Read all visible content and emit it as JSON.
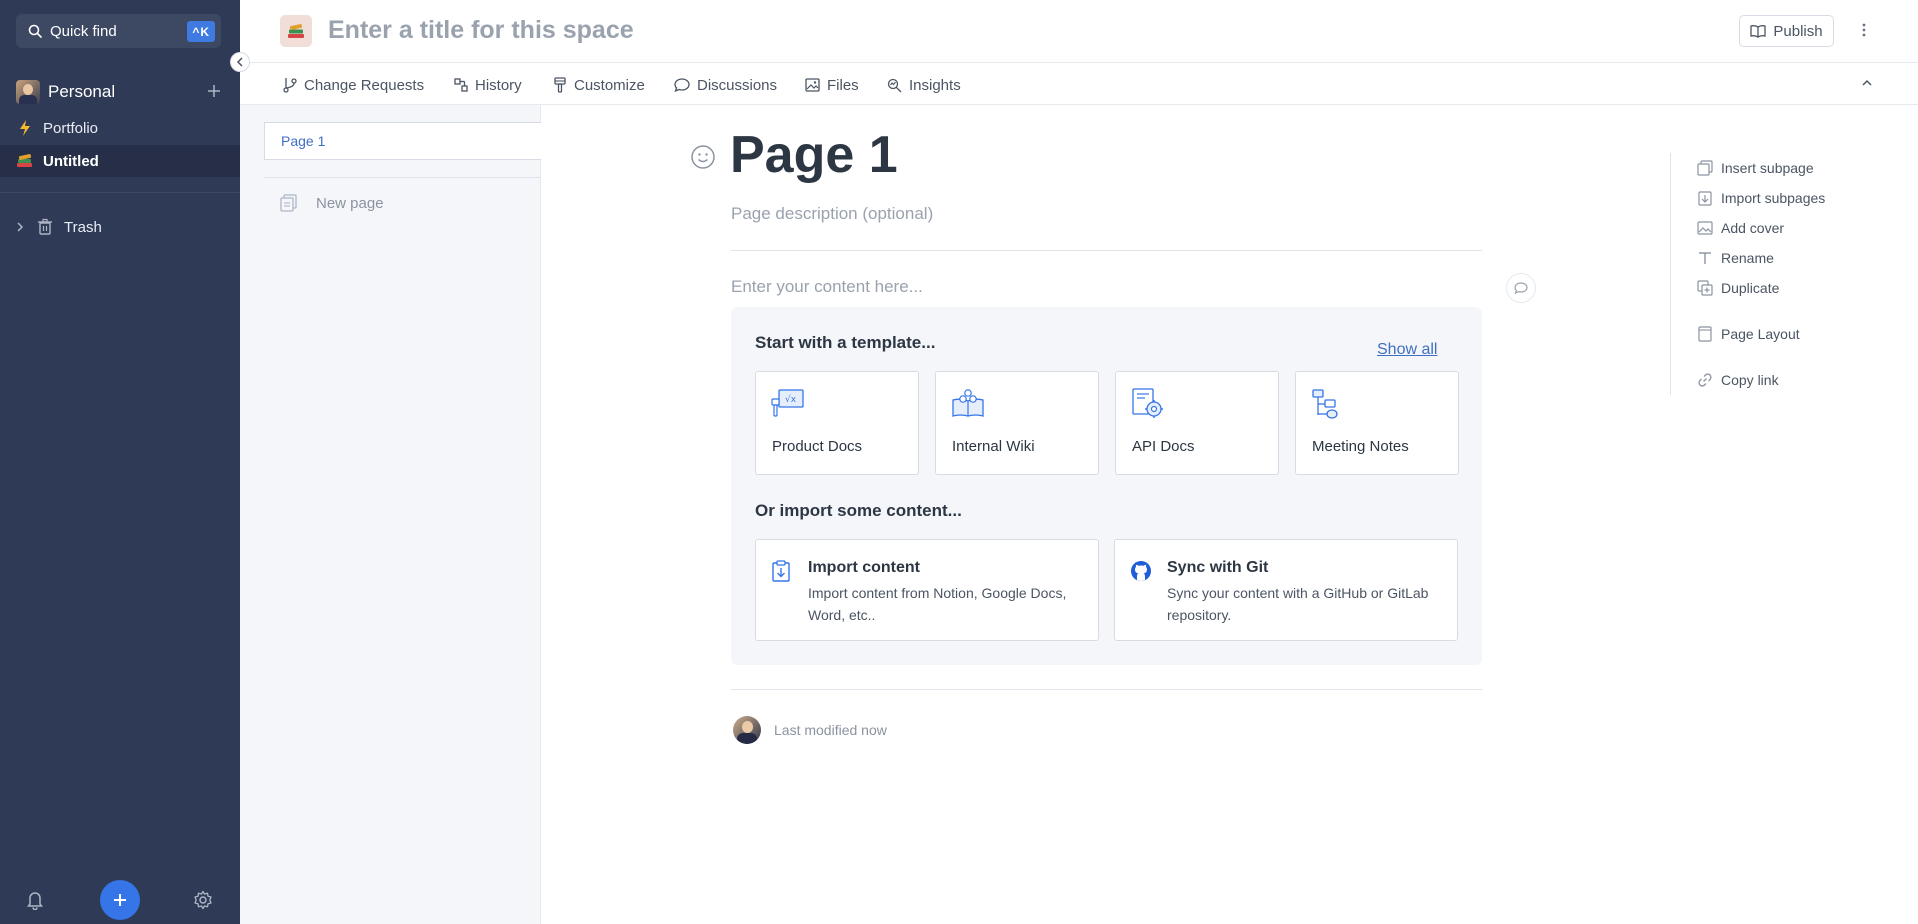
{
  "sidebar": {
    "quickfind_label": "Quick find",
    "quickfind_shortcut": "^K",
    "space_name": "Personal",
    "items": [
      {
        "label": "Portfolio",
        "icon": "lightning-icon"
      },
      {
        "label": "Untitled",
        "icon": "books-icon",
        "active": true
      }
    ],
    "trash_label": "Trash"
  },
  "header": {
    "title_placeholder": "Enter a title for this space",
    "publish_label": "Publish"
  },
  "tabs": [
    {
      "label": "Change Requests",
      "icon": "branch-icon"
    },
    {
      "label": "History",
      "icon": "history-icon"
    },
    {
      "label": "Customize",
      "icon": "brush-icon"
    },
    {
      "label": "Discussions",
      "icon": "chat-icon"
    },
    {
      "label": "Files",
      "icon": "image-icon"
    },
    {
      "label": "Insights",
      "icon": "insights-icon"
    }
  ],
  "tree": {
    "page_label": "Page 1",
    "new_page_label": "New page"
  },
  "page": {
    "title": "Page 1",
    "description_placeholder": "Page description (optional)",
    "content_placeholder": "Enter your content here..."
  },
  "templates": {
    "heading": "Start with a template...",
    "show_all": "Show all",
    "cards": [
      {
        "label": "Product Docs",
        "icon": "product-docs-icon"
      },
      {
        "label": "Internal Wiki",
        "icon": "internal-wiki-icon"
      },
      {
        "label": "API Docs",
        "icon": "api-docs-icon"
      },
      {
        "label": "Meeting Notes",
        "icon": "meeting-notes-icon"
      }
    ],
    "import_heading": "Or import some content...",
    "import_cards": [
      {
        "title": "Import content",
        "desc": "Import content from Notion, Google Docs, Word, etc..",
        "icon": "import-icon"
      },
      {
        "title": "Sync with Git",
        "desc": "Sync your content with a GitHub or GitLab repository.",
        "icon": "github-icon"
      }
    ]
  },
  "footer": {
    "last_modified": "Last modified now"
  },
  "actions": [
    {
      "label": "Insert subpage",
      "icon": "insert-subpage-icon"
    },
    {
      "label": "Import subpages",
      "icon": "import-subpages-icon"
    },
    {
      "label": "Add cover",
      "icon": "add-cover-icon"
    },
    {
      "label": "Rename",
      "icon": "rename-icon"
    },
    {
      "label": "Duplicate",
      "icon": "duplicate-icon"
    },
    {
      "label": "Page Layout",
      "icon": "page-layout-icon"
    },
    {
      "label": "Copy link",
      "icon": "copy-link-icon"
    }
  ],
  "colors": {
    "sidebar_bg": "#2f3a56",
    "accent": "#3575e8",
    "link": "#3f6fc4"
  }
}
